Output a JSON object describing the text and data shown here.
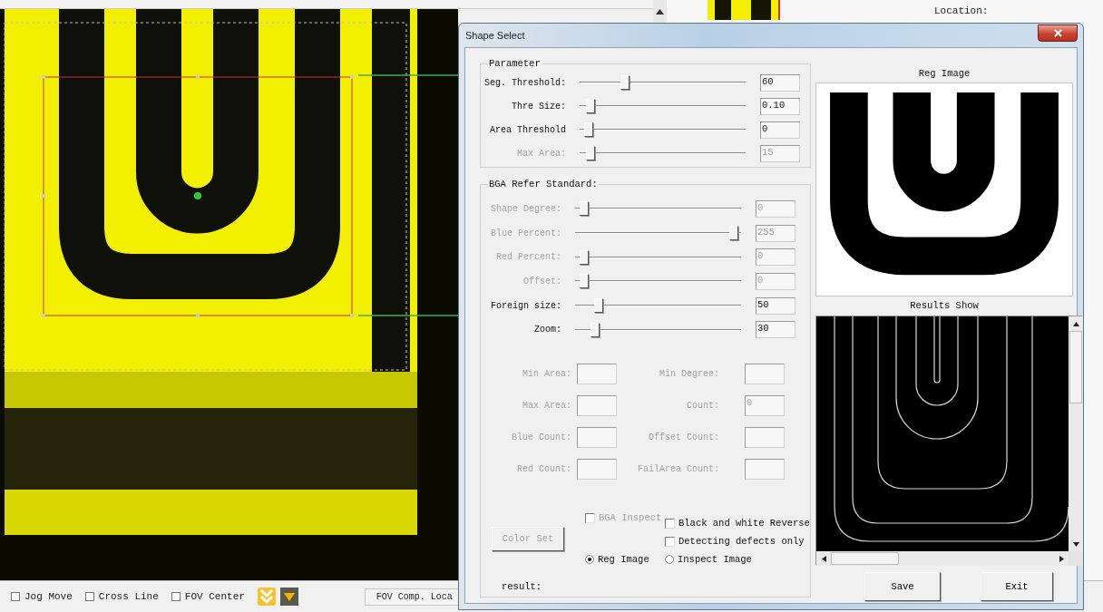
{
  "background": {
    "location_label": "Location:",
    "view_options": [
      {
        "label": "Jog Move",
        "checked": false
      },
      {
        "label": "Cross Line",
        "checked": false
      },
      {
        "label": "FOV Center",
        "checked": false
      }
    ],
    "fov_comp_label": "FOV Comp. Loca"
  },
  "dialog": {
    "title": "Shape Select",
    "parameter": {
      "title": "Parameter",
      "sliders": [
        {
          "label": "Seg. Threshold:",
          "level": 0.26,
          "value": "60",
          "disabled": false
        },
        {
          "label": "Thre Size:",
          "level": 0.04,
          "value": "0.10",
          "disabled": false
        },
        {
          "label": "Area Threshold",
          "level": 0.03,
          "value": "0",
          "disabled": false
        },
        {
          "label": "Max Area:",
          "level": 0.04,
          "value": "15",
          "disabled": true
        }
      ]
    },
    "bga": {
      "title": "BGA Refer Standard:",
      "sliders": [
        {
          "label": "Shape Degree:",
          "level": 0.03,
          "value": "0",
          "disabled": true
        },
        {
          "label": "Blue Percent:",
          "level": 0.98,
          "value": "255",
          "disabled": true
        },
        {
          "label": "Red Percent:",
          "level": 0.03,
          "value": "0",
          "disabled": true
        },
        {
          "label": "Offset:",
          "level": 0.03,
          "value": "0",
          "disabled": true
        },
        {
          "label": "Foreign size:",
          "level": 0.12,
          "value": "50",
          "disabled": false
        },
        {
          "label": "Zoom:",
          "level": 0.1,
          "value": "30",
          "disabled": false
        }
      ],
      "fields": [
        {
          "label": "Min Area:",
          "disabled": true
        },
        {
          "label": "Min Degree:",
          "disabled": true
        },
        {
          "label": "Max Area:",
          "disabled": true
        },
        {
          "label": "Count:",
          "value": "0",
          "disabled": true
        },
        {
          "label": "Blue Count:",
          "disabled": true
        },
        {
          "label": "Offset Count:",
          "disabled": true
        },
        {
          "label": "Red Count:",
          "disabled": true
        },
        {
          "label": "FailArea Count:",
          "disabled": true
        }
      ],
      "color_set_button": {
        "label": "Color Set",
        "disabled": true
      },
      "checkboxes": [
        {
          "label": "BGA Inspect",
          "checked": false,
          "disabled": true
        },
        {
          "label": "Black and white Reverse",
          "checked": false,
          "disabled": false
        },
        {
          "label": "Detecting defects only",
          "checked": false,
          "disabled": false
        }
      ],
      "radios": [
        {
          "label": "Reg Image",
          "selected": true
        },
        {
          "label": "Inspect Image",
          "selected": false
        }
      ],
      "result_label": "result:"
    },
    "reg_image_title": "Reg Image",
    "results_title": "Results Show",
    "buttons": [
      "Save",
      "Exit"
    ]
  }
}
